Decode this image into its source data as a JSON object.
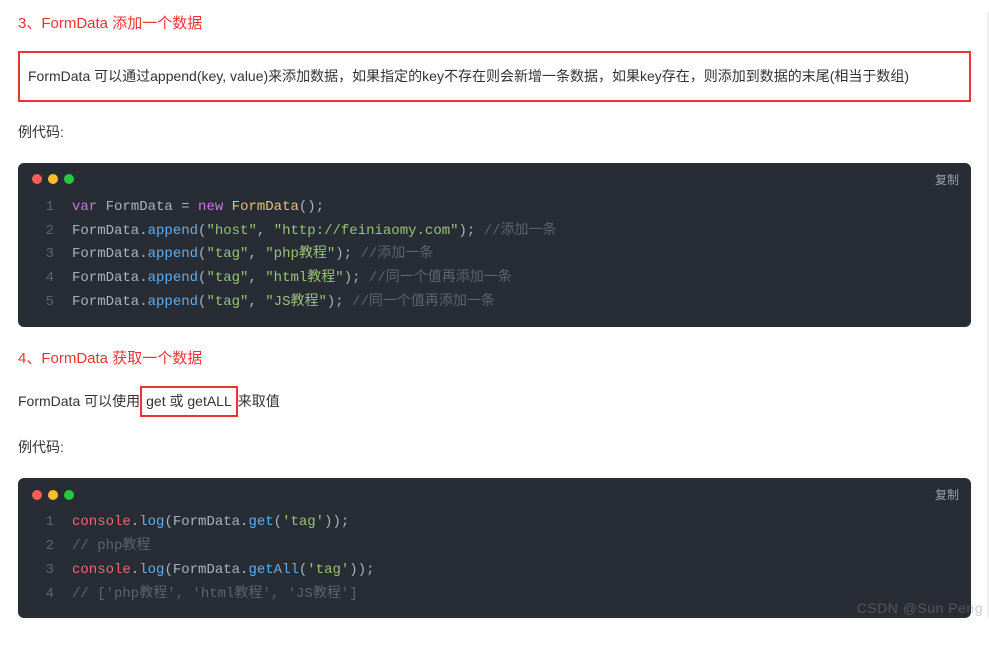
{
  "section3": {
    "heading": "3、FormData 添加一个数据",
    "box_text": "FormData 可以通过append(key, value)来添加数据，如果指定的key不存在则会新增一条数据，如果key存在，则添加到数据的末尾(相当于数组)",
    "example_label": "例代码:"
  },
  "code1": {
    "copy_label": "复制",
    "lines": {
      "l1": {
        "n": "1",
        "a": "var",
        "b": " FormData = ",
        "c": "new",
        "d": " ",
        "e": "FormData",
        "f": "();"
      },
      "l2": {
        "n": "2",
        "a": "FormData.",
        "b": "append",
        "c": "(",
        "d": "\"host\"",
        "e": ", ",
        "f": "\"http://feiniaomy.com\"",
        "g": "); ",
        "h": "//添加一条"
      },
      "l3": {
        "n": "3",
        "a": "FormData.",
        "b": "append",
        "c": "(",
        "d": "\"tag\"",
        "e": ", ",
        "f": "\"php教程\"",
        "g": "); ",
        "h": "//添加一条"
      },
      "l4": {
        "n": "4",
        "a": "FormData.",
        "b": "append",
        "c": "(",
        "d": "\"tag\"",
        "e": ", ",
        "f": "\"html教程\"",
        "g": "); ",
        "h": "//同一个值再添加一条"
      },
      "l5": {
        "n": "5",
        "a": "FormData.",
        "b": "append",
        "c": "(",
        "d": "\"tag\"",
        "e": ", ",
        "f": "\"JS教程\"",
        "g": "); ",
        "h": "//同一个值再添加一条"
      }
    }
  },
  "section4": {
    "heading": "4、FormData 获取一个数据",
    "para_before": "FormData 可以使用",
    "para_boxed": " get 或 getALL ",
    "para_after": "来取值",
    "example_label": "例代码:"
  },
  "code2": {
    "copy_label": "复制",
    "lines": {
      "l1": {
        "n": "1",
        "a": "console",
        "b": ".",
        "c": "log",
        "d": "(FormData.",
        "e": "get",
        "f": "(",
        "g": "'tag'",
        "h": "));"
      },
      "l2": {
        "n": "2",
        "a": "// php教程"
      },
      "l3": {
        "n": "3",
        "a": "console",
        "b": ".",
        "c": "log",
        "d": "(FormData.",
        "e": "getAll",
        "f": "(",
        "g": "'tag'",
        "h": "));"
      },
      "l4": {
        "n": "4",
        "a": "// ['php教程', 'html教程', 'JS教程']"
      }
    }
  },
  "watermark": "CSDN @Sun   Peng"
}
